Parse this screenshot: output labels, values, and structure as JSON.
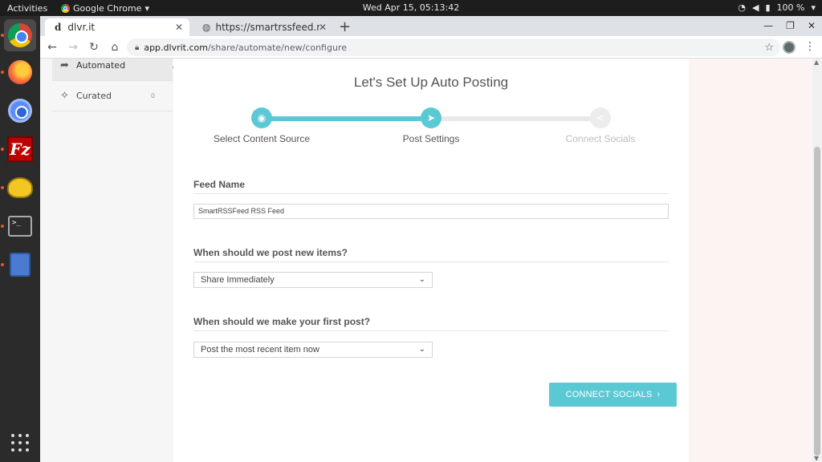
{
  "system": {
    "activities": "Activities",
    "app_name": "Google Chrome",
    "clock": "Wed Apr 15, 05:13:42",
    "battery": "100 %"
  },
  "dock": {
    "items": [
      "chrome-icon",
      "firefox-icon",
      "chromium-icon",
      "filezilla-icon",
      "teapot-icon",
      "terminal-icon",
      "file-cabinet-icon",
      "app-grid-icon"
    ],
    "filezilla_glyph": "Fz"
  },
  "browser": {
    "tabs": [
      {
        "title": "dlvr.it",
        "favicon": "d"
      },
      {
        "title": "https://smartrssfeed.mys"
      }
    ],
    "url": {
      "host": "app.dlvrit.com",
      "path": "/share/automate/new/configure"
    }
  },
  "sidebar": {
    "items": [
      {
        "label": "Automated",
        "icon": "share-arrow-icon",
        "active": true
      },
      {
        "label": "Curated",
        "icon": "magic-wand-icon",
        "count": "0"
      }
    ]
  },
  "wizard": {
    "title": "Let's Set Up Auto Posting",
    "progress": 0.5,
    "steps": [
      {
        "label": "Select Content Source",
        "icon": "rss-icon",
        "state": "done"
      },
      {
        "label": "Post Settings",
        "icon": "paper-plane-icon",
        "state": "current"
      },
      {
        "label": "Connect Socials",
        "icon": "share-nodes-icon",
        "state": "pending"
      }
    ],
    "feed_name": {
      "label": "Feed Name",
      "value": "SmartRSSFeed RSS Feed"
    },
    "post_timing": {
      "label": "When should we post new items?",
      "selected": "Share Immediately"
    },
    "first_post": {
      "label": "When should we make your first post?",
      "selected": "Post the most recent item now"
    },
    "next_button": "CONNECT SOCIALS"
  },
  "colors": {
    "accent": "#5bc9d3",
    "right_panel": "#fbf4f2"
  }
}
